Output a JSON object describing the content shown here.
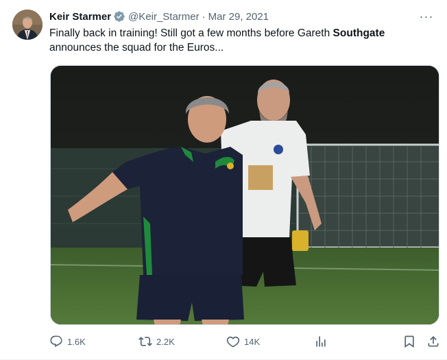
{
  "tweet": {
    "author_name": "Keir Starmer",
    "handle": "@Keir_Starmer",
    "separator": "·",
    "date": "Mar 29, 2021",
    "text_before": "Finally back in training! Still got a few months before Gareth ",
    "text_bold": "Southgate",
    "text_after": " announces the squad for the Euros...",
    "more_label": "···"
  },
  "icons": {
    "verified": "verified-badge-icon",
    "reply": "reply-icon",
    "retweet": "retweet-icon",
    "like": "heart-icon",
    "views": "views-chart-icon",
    "bookmark": "bookmark-icon",
    "share": "share-icon"
  },
  "actions": {
    "replies": "1.6K",
    "retweets": "2.2K",
    "likes": "14K"
  },
  "colors": {
    "verified": "#829aab",
    "secondary_text": "#536471",
    "primary_text": "#0f1419"
  }
}
